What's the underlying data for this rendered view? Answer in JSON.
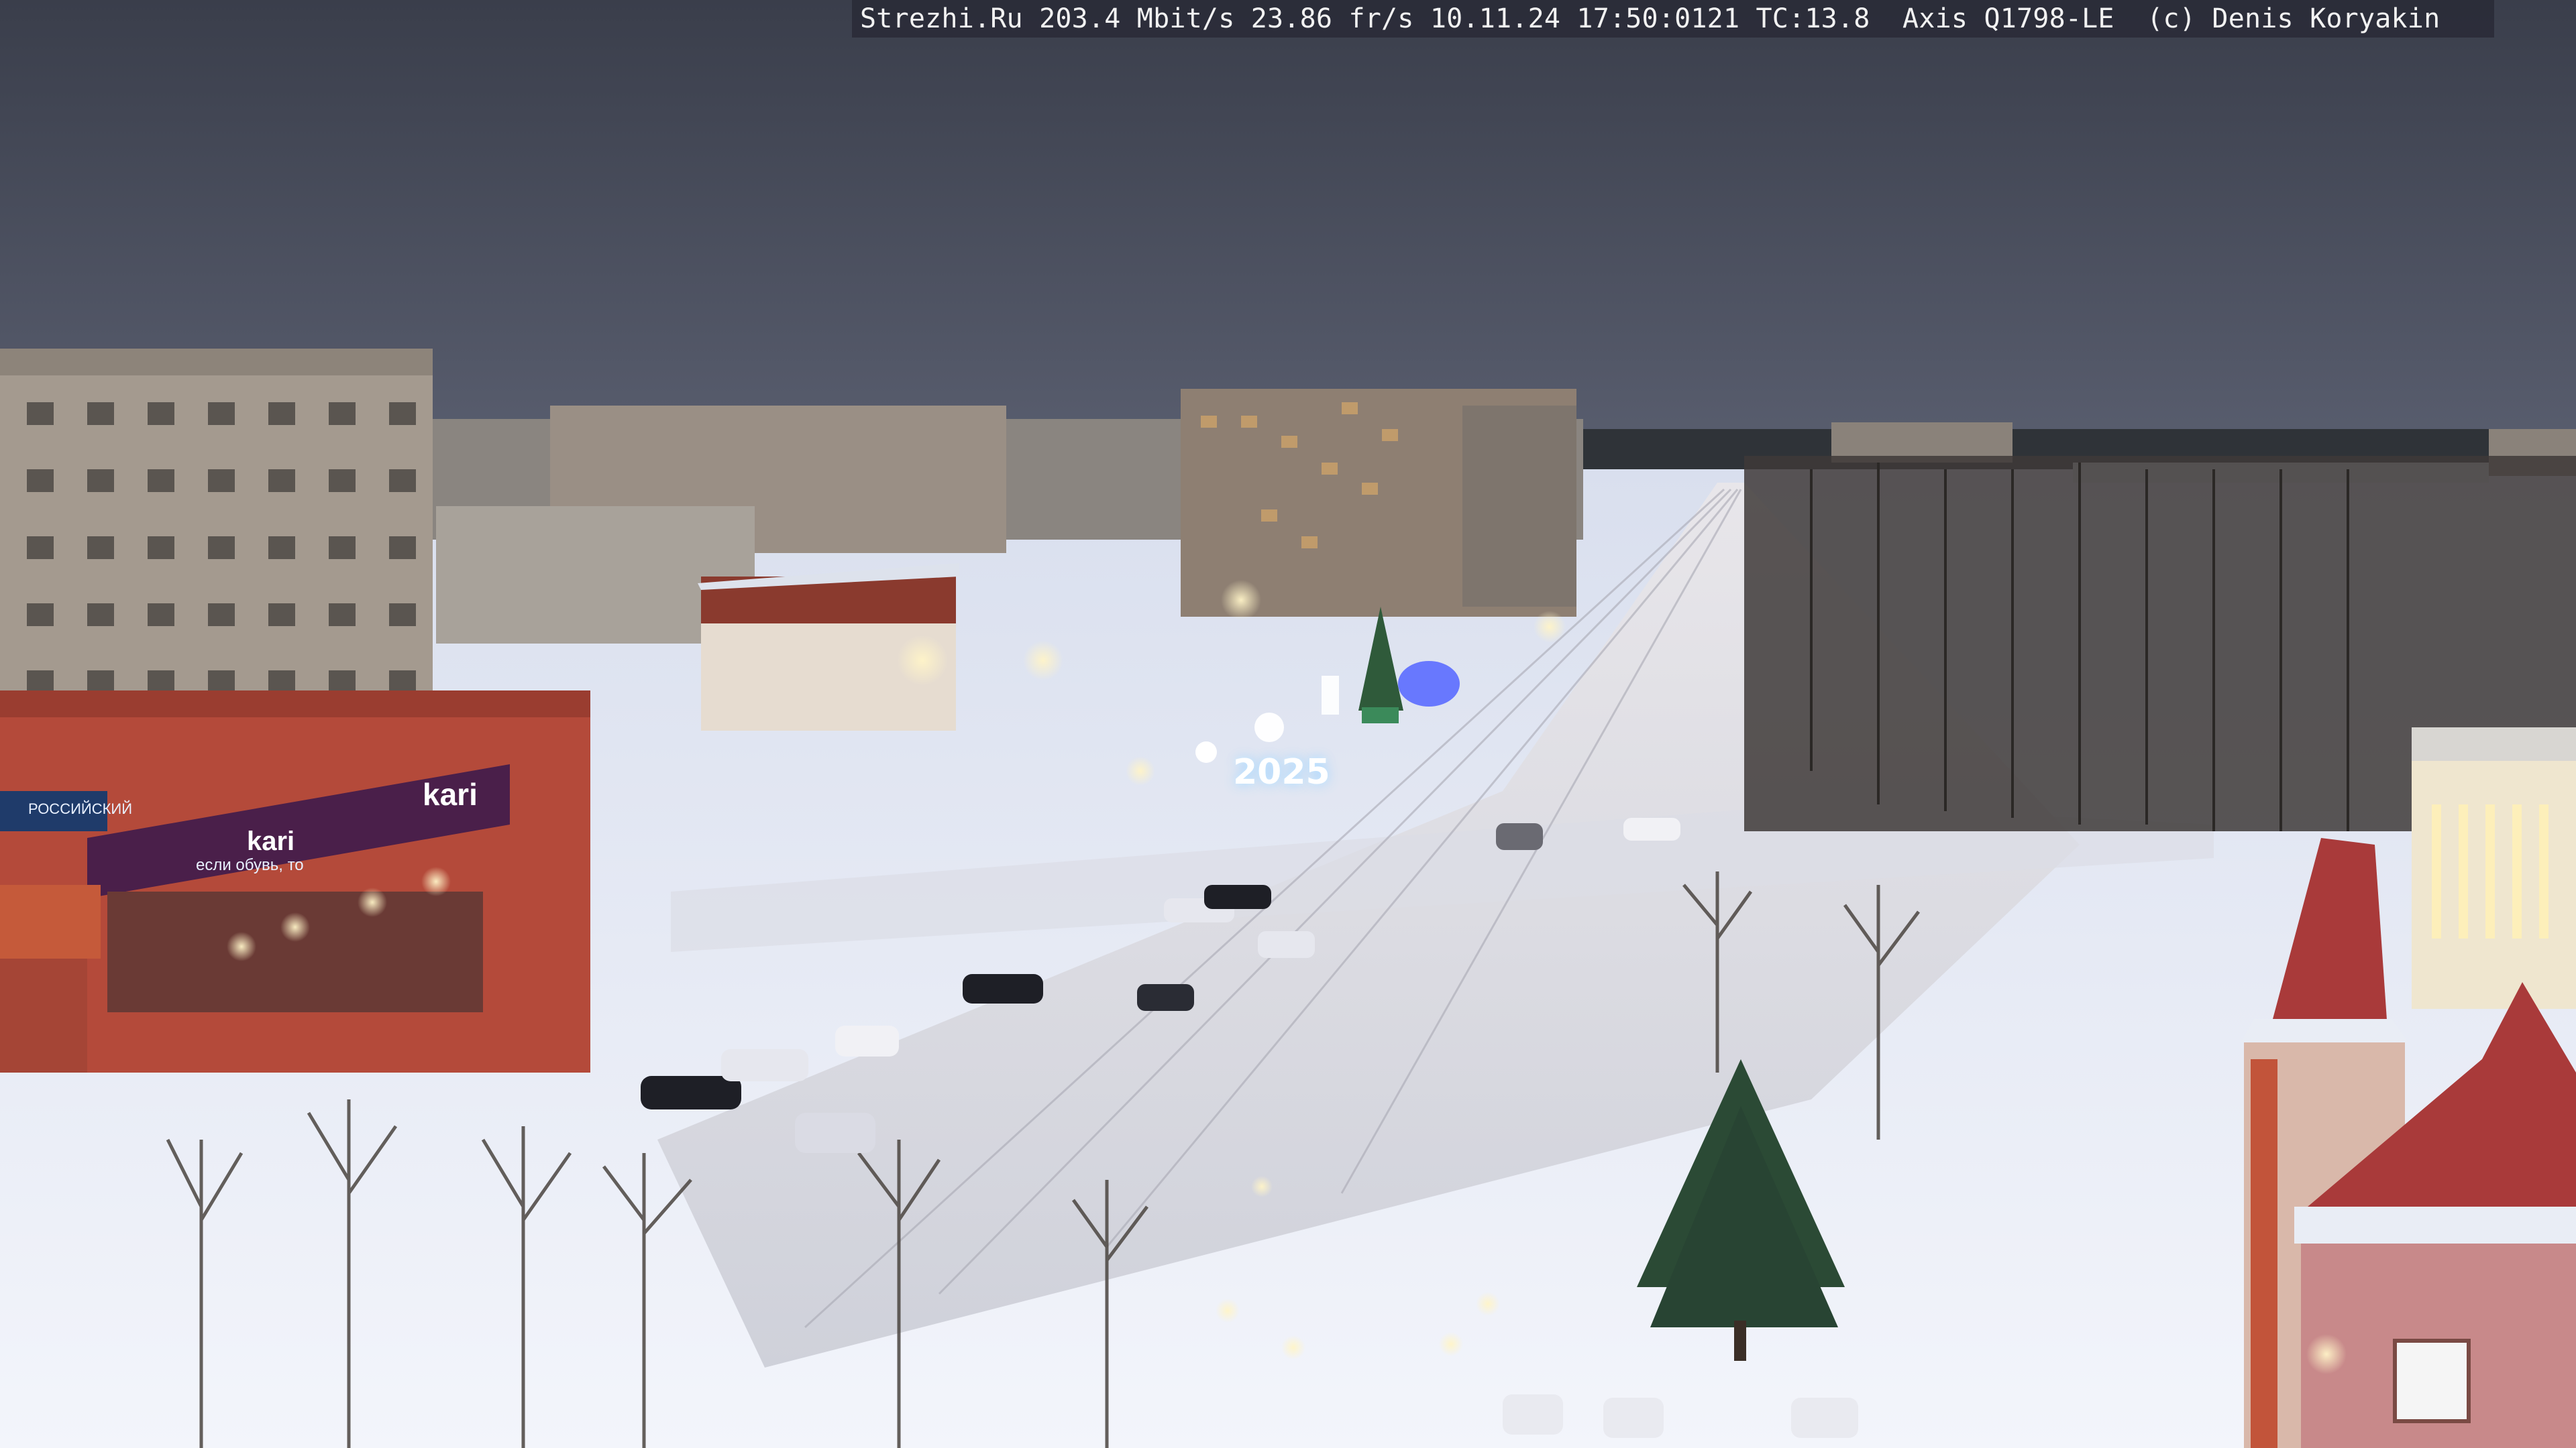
{
  "overlay": {
    "caption": "Strezhi.Ru 203.4 Mbit/s 23.86 fr/s 10.11.24 17:50:0121 TC:13.8  Axis Q1798-LE  (c) Denis Koryakin"
  },
  "signs": {
    "kari_main": "kari",
    "kari_secondary": "kari",
    "tagline": "если обувь, то",
    "bank": "РОССИЙСКИЙ",
    "year": "2025"
  },
  "colors": {
    "sky": "#3b3f4c",
    "snow": "#e8ecf5",
    "shop_facade": "#b44a3a",
    "kari_band": "#4a1f4a",
    "tree_lights": "#5b6cff"
  }
}
